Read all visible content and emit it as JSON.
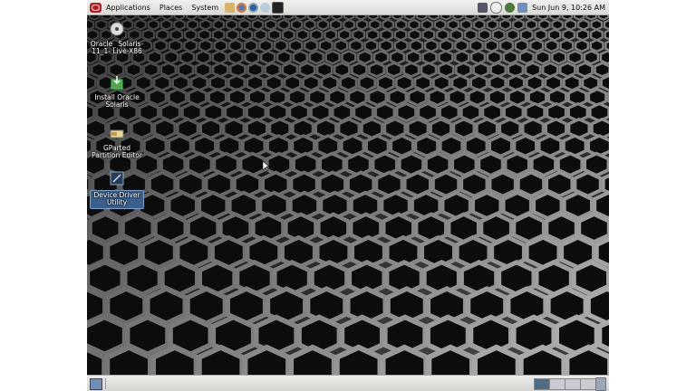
{
  "topbar": {
    "menus": [
      "Applications",
      "Places",
      "System"
    ],
    "clock": "Sun Jun  9, 10:26 AM"
  },
  "desktop_icons": [
    {
      "label": "Oracle_ Solaris-11_1- Live-X86",
      "icon": "cd-icon"
    },
    {
      "label": "Install Oracle Solaris",
      "icon": "install-icon"
    },
    {
      "label": "GParted Partition Editor",
      "icon": "gparted-icon"
    },
    {
      "label": "Device Driver Utility",
      "icon": "device-driver-icon",
      "selected": true
    }
  ],
  "colors": {
    "selection": "#3a5f8c",
    "oracle_red": "#c4161c"
  }
}
